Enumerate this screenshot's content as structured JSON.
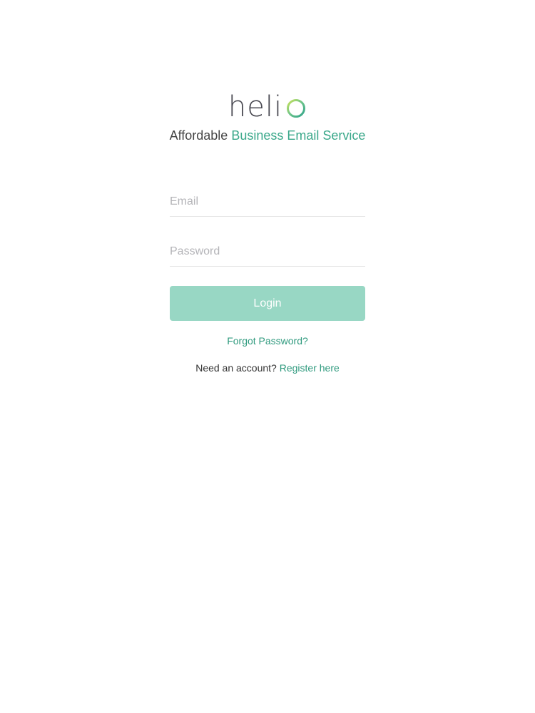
{
  "brand": {
    "logo_text": "heli",
    "tagline_plain": "Affordable",
    "tagline_accent": "Business Email Service",
    "accent_color": "#3aa88a",
    "button_color": "#98d7c4"
  },
  "form": {
    "email_placeholder": "Email",
    "email_value": "",
    "password_placeholder": "Password",
    "password_value": "",
    "login_label": "Login"
  },
  "links": {
    "forgot_password": "Forgot Password?",
    "need_account": "Need an account?",
    "register": "Register here"
  }
}
